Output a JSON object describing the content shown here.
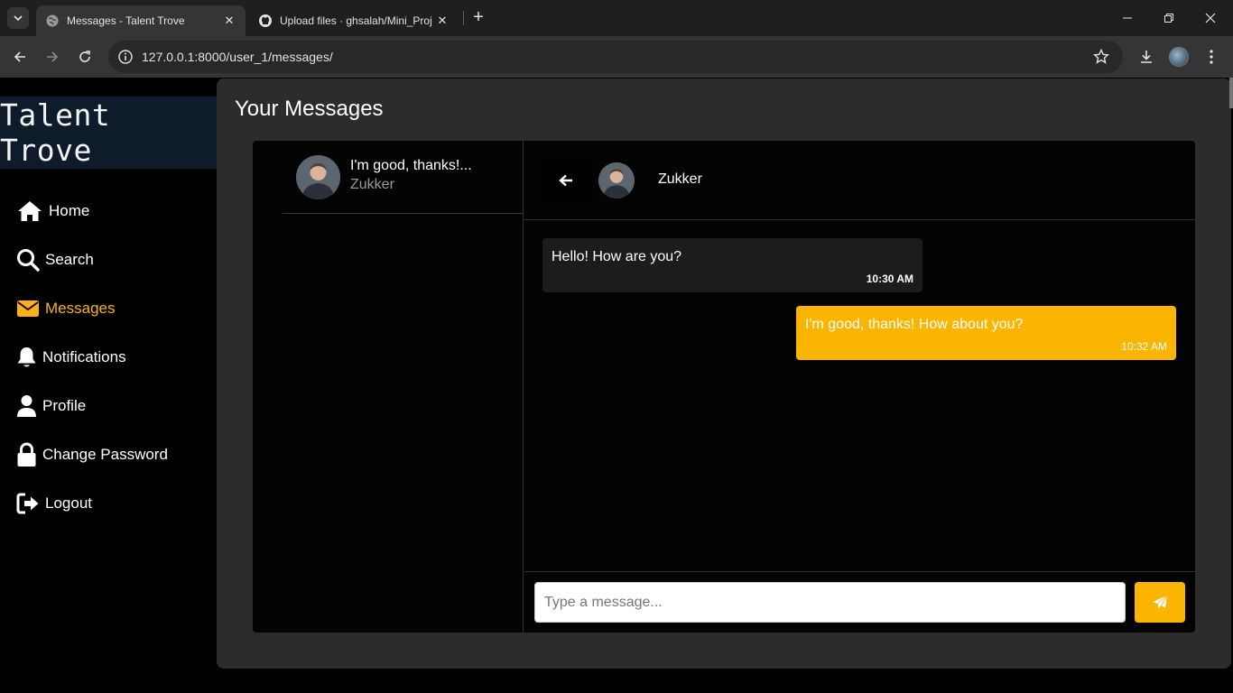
{
  "browser": {
    "tabs": [
      {
        "title": "Messages - Talent Trove",
        "active": true
      },
      {
        "title": "Upload files · ghsalah/Mini_Proj",
        "active": false
      }
    ],
    "url": "127.0.0.1:8000/user_1/messages/"
  },
  "app": {
    "brand": "Talent Trove",
    "accent_color": "#fbb400",
    "sidebar": {
      "items": [
        {
          "label": "Home",
          "icon": "home-icon"
        },
        {
          "label": "Search",
          "icon": "search-icon"
        },
        {
          "label": "Messages",
          "icon": "envelope-icon",
          "active": true
        },
        {
          "label": "Notifications",
          "icon": "bell-icon"
        },
        {
          "label": "Profile",
          "icon": "user-icon"
        },
        {
          "label": "Change Password",
          "icon": "lock-icon"
        },
        {
          "label": "Logout",
          "icon": "logout-icon"
        }
      ]
    }
  },
  "main": {
    "title": "Your Messages",
    "conversations": [
      {
        "preview": "I'm good, thanks!...",
        "name": "Zukker"
      }
    ],
    "chat": {
      "contact_name": "Zukker",
      "messages": [
        {
          "direction": "incoming",
          "text": "Hello! How are you?",
          "time": "10:30 AM"
        },
        {
          "direction": "outgoing",
          "text": "I'm good, thanks! How about you?",
          "time": "10:32 AM"
        }
      ],
      "input_placeholder": "Type a message..."
    }
  }
}
